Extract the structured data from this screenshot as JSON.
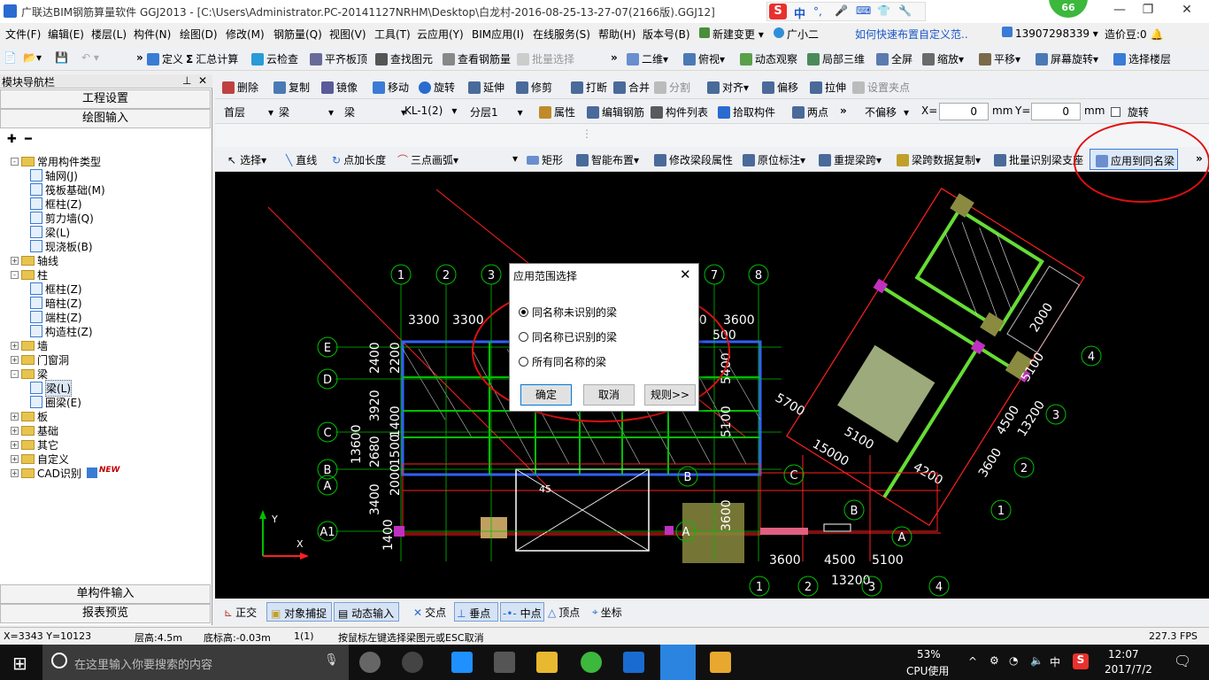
{
  "window": {
    "title": "广联达BIM钢筋算量软件 GGJ2013 - [C:\\Users\\Administrator.PC-20141127NRHM\\Desktop\\白龙村-2016-08-25-13-27-07(2166版).GGJ12]",
    "ime_label": "中",
    "badge": "66"
  },
  "menu": [
    "文件(F)",
    "编辑(E)",
    "楼层(L)",
    "构件(N)",
    "绘图(D)",
    "修改(M)",
    "钢筋量(Q)",
    "视图(V)",
    "工具(T)",
    "云应用(Y)",
    "BIM应用(I)",
    "在线服务(S)",
    "帮助(H)",
    "版本号(B)",
    "新建变更",
    "广小二",
    "如何快速布置自定义范..",
    "13907298339",
    "造价豆:0"
  ],
  "toolbar1": [
    "定义",
    "汇总计算",
    "云检查",
    "平齐板顶",
    "查找图元",
    "查看钢筋量",
    "批量选择",
    "二维",
    "俯视",
    "动态观察",
    "局部三维",
    "全屏",
    "缩放",
    "平移",
    "屏幕旋转",
    "选择楼层"
  ],
  "toolbar2": [
    "删除",
    "复制",
    "镜像",
    "移动",
    "旋转",
    "延伸",
    "修剪",
    "打断",
    "合并",
    "分割",
    "对齐",
    "偏移",
    "拉伸",
    "设置夹点"
  ],
  "toolbar3": {
    "floor": "首层",
    "type": "梁",
    "subtype": "梁",
    "member": "KL-1(2)",
    "layer": "分层1",
    "items": [
      "属性",
      "编辑钢筋",
      "构件列表",
      "拾取构件",
      "两点"
    ],
    "offset": "不偏移",
    "x_label": "X=",
    "x_value": "0",
    "unit": "mm",
    "y_label": "Y=",
    "y_value": "0",
    "rotate": "旋转"
  },
  "toolbar4": [
    "选择",
    "直线",
    "点加长度",
    "三点画弧",
    "矩形",
    "智能布置",
    "修改梁段属性",
    "原位标注",
    "重提梁跨",
    "梁跨数据复制",
    "批量识别梁支座",
    "应用到同名梁"
  ],
  "left_panel": {
    "title": "模块导航栏",
    "pin": "ņ",
    "btn_settings": "工程设置",
    "btn_draw": "绘图输入",
    "tree": [
      {
        "label": "常用构件类型",
        "level": 0,
        "kind": "folder",
        "toggle": "-"
      },
      {
        "label": "轴网(J)",
        "level": 1,
        "kind": "item"
      },
      {
        "label": "筏板基础(M)",
        "level": 1,
        "kind": "item"
      },
      {
        "label": "框柱(Z)",
        "level": 1,
        "kind": "item"
      },
      {
        "label": "剪力墙(Q)",
        "level": 1,
        "kind": "item"
      },
      {
        "label": "梁(L)",
        "level": 1,
        "kind": "item"
      },
      {
        "label": "现浇板(B)",
        "level": 1,
        "kind": "item"
      },
      {
        "label": "轴线",
        "level": 0,
        "kind": "folder",
        "toggle": "+"
      },
      {
        "label": "柱",
        "level": 0,
        "kind": "folder",
        "toggle": "-"
      },
      {
        "label": "框柱(Z)",
        "level": 1,
        "kind": "item"
      },
      {
        "label": "暗柱(Z)",
        "level": 1,
        "kind": "item"
      },
      {
        "label": "端柱(Z)",
        "level": 1,
        "kind": "item"
      },
      {
        "label": "构造柱(Z)",
        "level": 1,
        "kind": "item"
      },
      {
        "label": "墙",
        "level": 0,
        "kind": "folder",
        "toggle": "+"
      },
      {
        "label": "门窗洞",
        "level": 0,
        "kind": "folder",
        "toggle": "+"
      },
      {
        "label": "梁",
        "level": 0,
        "kind": "folder",
        "toggle": "-"
      },
      {
        "label": "梁(L)",
        "level": 1,
        "kind": "item",
        "selected": true
      },
      {
        "label": "圈梁(E)",
        "level": 1,
        "kind": "item"
      },
      {
        "label": "板",
        "level": 0,
        "kind": "folder",
        "toggle": "+"
      },
      {
        "label": "基础",
        "level": 0,
        "kind": "folder",
        "toggle": "+"
      },
      {
        "label": "其它",
        "level": 0,
        "kind": "folder",
        "toggle": "+"
      },
      {
        "label": "自定义",
        "level": 0,
        "kind": "folder",
        "toggle": "+"
      },
      {
        "label": "CAD识别",
        "level": 0,
        "kind": "folder",
        "toggle": "+",
        "new": "NEW"
      }
    ],
    "btn_single": "单构件输入",
    "btn_report": "报表预览"
  },
  "canvas": {
    "axis_top": [
      "1",
      "2",
      "3",
      "7",
      "8"
    ],
    "axis_left": [
      "E",
      "D",
      "C",
      "B",
      "A",
      "A1"
    ],
    "dims_top": [
      "3300",
      "3300",
      "3300",
      "3600",
      "500"
    ],
    "dims_left": [
      "2400",
      "2200",
      "3920",
      "1400",
      "2680",
      "1500",
      "2000",
      "3400",
      "1400",
      "13600"
    ],
    "dims_right": [
      "2000",
      "5100",
      "4500",
      "13200",
      "3600",
      "4200",
      "5700",
      "5100",
      "15000",
      "5100",
      "5400",
      "3600"
    ],
    "dims_bottom": [
      "3600",
      "4500",
      "5100",
      "13200"
    ],
    "axis_bottom": [
      "1",
      "2",
      "3",
      "4"
    ],
    "axis_right": [
      "4",
      "3",
      "2",
      "1"
    ],
    "grid_labels": [
      "B",
      "C",
      "A",
      "B",
      "A"
    ],
    "misc": [
      "45"
    ],
    "coord_x": "X",
    "coord_y": "Y"
  },
  "dialog": {
    "title": "应用范围选择",
    "options": [
      {
        "label": "同名称未识别的梁",
        "checked": true
      },
      {
        "label": "同名称已识别的梁",
        "checked": false
      },
      {
        "label": "所有同名称的梁",
        "checked": false
      }
    ],
    "ok": "确定",
    "cancel": "取消",
    "rules": "规则>>"
  },
  "snapbar": [
    "正交",
    "对象捕捉",
    "动态输入",
    "交点",
    "垂点",
    "中点",
    "顶点",
    "坐标"
  ],
  "status": {
    "coords": "X=3343 Y=10123",
    "floor_height": "层高:4.5m",
    "base_height": "底标高:-0.03m",
    "count": "1(1)",
    "hint": "按鼠标左键选择梁图元或ESC取消",
    "fps": "227.3 FPS"
  },
  "taskbar": {
    "search_placeholder": "在这里输入你要搜索的内容",
    "cpu_pct": "53%",
    "cpu_label": "CPU使用",
    "ime": "中",
    "time": "12:07",
    "date": "2017/7/2"
  },
  "colors": {
    "accent_red": "#e01010",
    "canvas_bg": "#000000",
    "cad_green": "#00c000",
    "cad_red": "#ff2020",
    "cad_blue": "#3060ff"
  }
}
